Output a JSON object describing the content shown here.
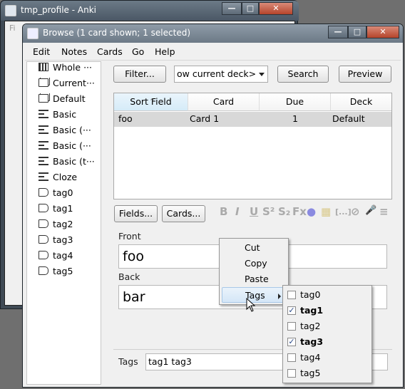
{
  "background_window": {
    "title": "tmp_profile - Anki",
    "menu_stub": "Fi"
  },
  "window": {
    "title": "Browse (1 card shown; 1 selected)",
    "controls": {
      "minimize": "—",
      "maximize": "□",
      "close": "✕"
    }
  },
  "menubar": {
    "items": [
      "Edit",
      "Notes",
      "Cards",
      "Go",
      "Help"
    ]
  },
  "sidebar": {
    "items": [
      {
        "label": "Whole ···",
        "icon": "whole-collection-icon"
      },
      {
        "label": "Current···",
        "icon": "deck-icon"
      },
      {
        "label": "Default",
        "icon": "deck-icon"
      },
      {
        "label": "Basic",
        "icon": "note-type-icon"
      },
      {
        "label": "Basic (···",
        "icon": "note-type-icon"
      },
      {
        "label": "Basic (···",
        "icon": "note-type-icon"
      },
      {
        "label": "Basic (t···",
        "icon": "note-type-icon"
      },
      {
        "label": "Cloze",
        "icon": "note-type-icon"
      },
      {
        "label": "tag0",
        "icon": "tag-icon"
      },
      {
        "label": "tag1",
        "icon": "tag-icon"
      },
      {
        "label": "tag2",
        "icon": "tag-icon"
      },
      {
        "label": "tag3",
        "icon": "tag-icon"
      },
      {
        "label": "tag4",
        "icon": "tag-icon"
      },
      {
        "label": "tag5",
        "icon": "tag-icon"
      }
    ]
  },
  "toolbar": {
    "filter_label": "Filter...",
    "search_value": "ow current deck>",
    "search_label": "Search",
    "preview_label": "Preview"
  },
  "table": {
    "columns": [
      "Sort Field",
      "Card",
      "Due",
      "Deck"
    ],
    "rows": [
      {
        "sort_field": "foo",
        "card": "Card 1",
        "due": "1",
        "deck": "Default"
      }
    ]
  },
  "editor": {
    "fields_label": "Fields...",
    "cards_label": "Cards...",
    "tools": [
      "B",
      "I",
      "U",
      "S²",
      "S₂",
      "Fx",
      "●",
      "▦",
      "[...]",
      "⊘",
      "🎤",
      "≡"
    ],
    "front_label": "Front",
    "front_value": "foo",
    "back_label": "Back",
    "back_value": "bar",
    "tags_label": "Tags",
    "tags_value": "tag1 tag3"
  },
  "context_menu": {
    "items": [
      "Cut",
      "Copy",
      "Paste",
      "Tags"
    ],
    "highlighted": "Tags"
  },
  "tags_submenu": {
    "items": [
      {
        "label": "tag0",
        "checked": false
      },
      {
        "label": "tag1",
        "checked": true
      },
      {
        "label": "tag2",
        "checked": false
      },
      {
        "label": "tag3",
        "checked": true
      },
      {
        "label": "tag4",
        "checked": false
      },
      {
        "label": "tag5",
        "checked": false
      }
    ]
  },
  "colors": {
    "selected_row": "#d8d8d8",
    "title_text": "#ffffff",
    "accent_check": "#2a4a8a"
  }
}
